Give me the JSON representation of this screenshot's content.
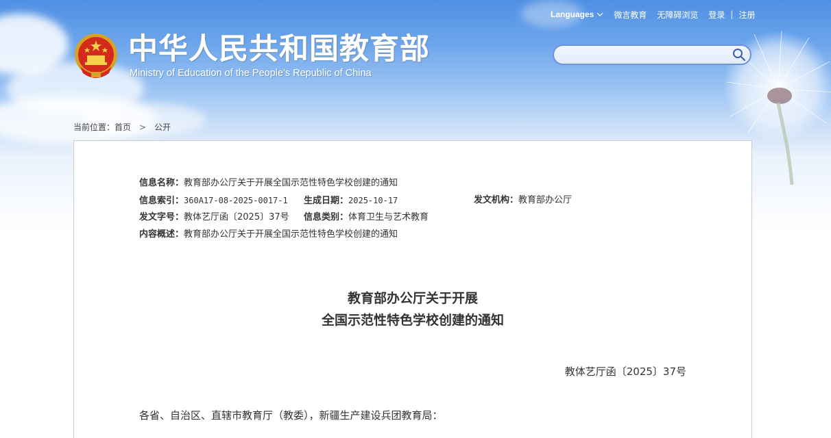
{
  "header": {
    "site_title": "中华人民共和国教育部",
    "site_subtitle": "Ministry of Education of the People's Republic of China",
    "emblem_icon": "national-emblem-icon"
  },
  "topnav": {
    "languages": "Languages",
    "weibo": "微言教育",
    "accessible": "无障碍浏览",
    "login": "登录",
    "separator": "|",
    "register": "注册"
  },
  "search": {
    "placeholder": "",
    "value": "",
    "icon": "search-icon"
  },
  "breadcrumb": {
    "prefix": "当前位置：",
    "home": "首页",
    "arrow": ">",
    "current": "公开"
  },
  "meta": {
    "name_label": "信息名称：",
    "name_value": "教育部办公厅关于开展全国示范性特色学校创建的通知",
    "index_label": "信息索引：",
    "index_value": "360A17-08-2025-0017-1",
    "date_label": "生成日期：",
    "date_value": "2025-10-17",
    "org_label": "发文机构：",
    "org_value": "教育部办公厅",
    "docno_label": "发文字号：",
    "docno_value": "教体艺厅函〔2025〕37号",
    "category_label": "信息类别：",
    "category_value": "体育卫生与艺术教育",
    "summary_label": "内容概述：",
    "summary_value": "教育部办公厅关于开展全国示范性特色学校创建的通知"
  },
  "document": {
    "title_line1": "教育部办公厅关于开展",
    "title_line2": "全国示范性特色学校创建的通知",
    "number": "教体艺厅函〔2025〕37号",
    "salutation": "各省、自治区、直辖市教育厅（教委），新疆生产建设兵团教育局："
  },
  "colors": {
    "sky_top": "#4f8fe2",
    "search_border": "#6d91d8",
    "card_border": "#c8cdd4",
    "text": "#333333"
  }
}
